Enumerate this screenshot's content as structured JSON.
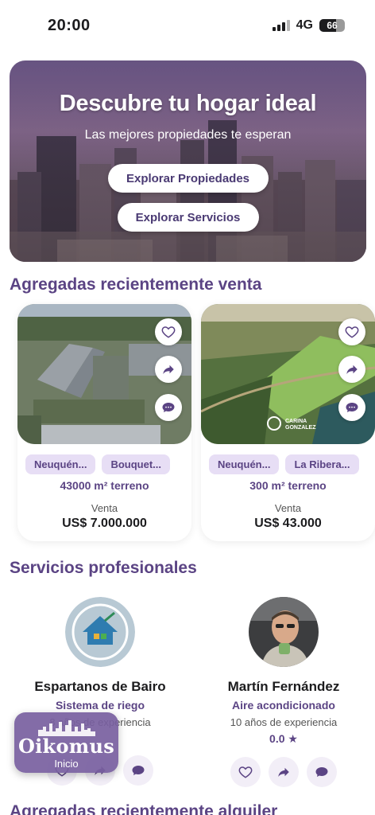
{
  "status": {
    "time": "20:00",
    "network": "4G",
    "battery": "66",
    "battery_level": 0.66
  },
  "hero": {
    "title": "Descubre tu hogar ideal",
    "subtitle": "Las mejores propiedades te esperan",
    "btn_properties": "Explorar Propiedades",
    "btn_services": "Explorar Servicios"
  },
  "sections": {
    "recent_sale": "Agregadas recientemente venta",
    "services": "Servicios profesionales",
    "recent_rent": "Agregadas recientemente alquiler"
  },
  "properties": [
    {
      "tag1": "Neuquén...",
      "tag2": "Bouquet...",
      "area": "43000 m² terreno",
      "operation": "Venta",
      "price": "US$ 7.000.000"
    },
    {
      "tag1": "Neuquén...",
      "tag2": "La Ribera...",
      "area": "300 m² terreno",
      "operation": "Venta",
      "price": "US$ 43.000",
      "watermark": "CARINA GONZALEZ"
    }
  ],
  "services": [
    {
      "name": "Espartanos de Bairo",
      "category": "Sistema de riego",
      "experience": "8 años de experiencia"
    },
    {
      "name": "Martín Fernández",
      "category": "Aire acondicionado",
      "experience": "10 años de experiencia",
      "rating": "0.0 ★"
    }
  ],
  "logo": {
    "brand": "Oikomus",
    "caption": "Inicio"
  },
  "colors": {
    "accent": "#5b4484",
    "tag_bg": "#e7def5"
  }
}
